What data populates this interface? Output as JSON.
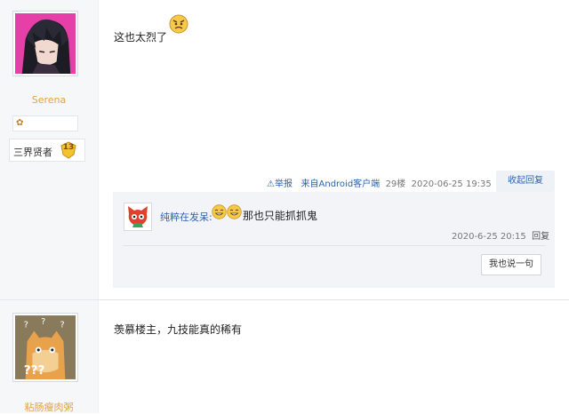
{
  "posts": [
    {
      "author": {
        "name": "Serena",
        "avatar_icon": "anime-boy-avatar",
        "badge_icon": "bear-badge-icon",
        "level_title": "三界贤者",
        "level": "13"
      },
      "content": "这也太烈了",
      "emoji": "angry-face-emoji",
      "meta": {
        "report": "举报",
        "client": "来自Android客户端",
        "floor": "29楼",
        "time": "2020-06-25 19:35",
        "collapse_label": "收起回复"
      },
      "replies": [
        {
          "user": "纯粹在发呆:",
          "avatar_icon": "red-cat-avatar",
          "emojis": [
            "grin-face-emoji",
            "grin-face-emoji"
          ],
          "text": "那也只能抓抓鬼",
          "time": "2020-6-25 20:15",
          "reply_label": "回复"
        }
      ],
      "say_button": "我也说一句"
    },
    {
      "author": {
        "name": "粘肠瘦肉粥",
        "avatar_icon": "confused-cat-avatar"
      },
      "content": "羡慕楼主，九技能真的稀有"
    }
  ],
  "colors": {
    "link": "#2d64b3",
    "username": "#e0a34a",
    "left_bg": "#f6f7f9",
    "reply_bg": "#f3f4f7"
  }
}
